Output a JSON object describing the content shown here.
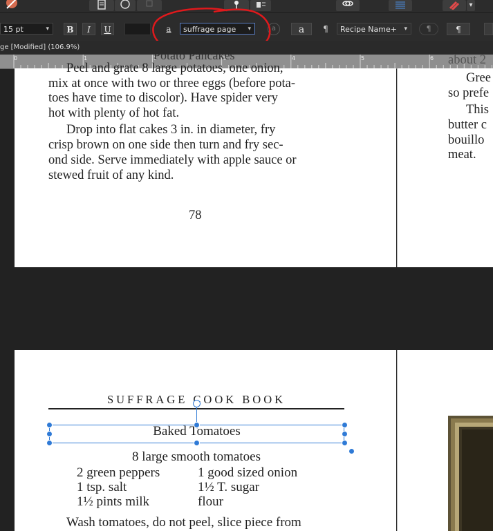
{
  "toolbar": {
    "font_size": "15 pt",
    "bold_label": "B",
    "italic_label": "I",
    "underline_label": "U",
    "char_style_glyph": "a",
    "char_style_value": "suffrage page",
    "char_reset_glyph": "a",
    "char_style_glyph2": "a",
    "para_glyph": "¶",
    "para_style_value": "Recipe Name+",
    "para_btn1": "¶",
    "para_btn2": "¶"
  },
  "document": {
    "tab_title": "ge [Modified] (106.9%)"
  },
  "ruler": {
    "labels": [
      "0",
      "1",
      "2",
      "3",
      "4",
      "5",
      "6"
    ]
  },
  "page_top": {
    "cut_heading": "Potato Pancakes",
    "lines": [
      "Peel and grate 8 large potatoes, one onion,",
      "mix at once with two or three eggs (before pota-",
      "toes have time to discolor). Have spider very",
      "hot with plenty of hot fat.",
      "Drop into flat cakes 3 in. in diameter, fry",
      "crisp brown on one side then turn and fry sec-",
      "ond side. Serve immediately with apple sauce or",
      "stewed fruit of any kind."
    ],
    "page_number": "78"
  },
  "page_right_top": {
    "lines": [
      "about 2",
      "Gree",
      "so prefe",
      "This",
      "butter c",
      "bouillo",
      "meat."
    ]
  },
  "page_bottom": {
    "running_head": "SUFFRAGE COOK BOOK",
    "recipe_title": "Baked Tomatoes",
    "ingredient_center": "8 large smooth tomatoes",
    "ingredients_left": [
      "2 green peppers",
      "1 tsp. salt",
      "1½ pints milk"
    ],
    "ingredients_right": [
      "1 good sized onion",
      "1½ T. sugar",
      "flour"
    ],
    "method_line": "Wash tomatoes, do not peel, slice piece from"
  },
  "colors": {
    "annotation_red": "#e0191c",
    "selection_blue": "#2f7ad6"
  }
}
